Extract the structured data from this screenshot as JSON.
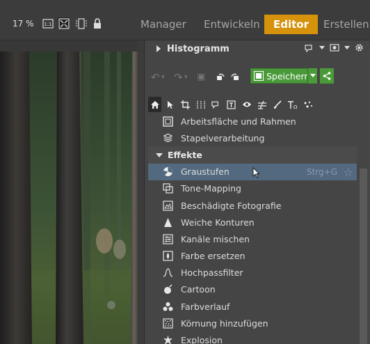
{
  "topbar": {
    "zoom": "17 %",
    "icons": [
      "one-to-one-icon",
      "fit-icon",
      "fill-icon",
      "lock-icon"
    ],
    "tabs": [
      {
        "label": "Manager",
        "active": false
      },
      {
        "label": "Entwickeln",
        "active": false
      },
      {
        "label": "Editor",
        "active": true
      },
      {
        "label": "Erstellen",
        "active": false
      }
    ]
  },
  "panel": {
    "histogram_title": "Histogramm",
    "save_label": "Speichern",
    "tool_icons": [
      "home-icon",
      "pointer-icon",
      "crop-icon",
      "transform-icon",
      "selection-icon",
      "text-frame-icon",
      "eye-icon",
      "adjust-icon",
      "brush-icon",
      "text-icon",
      "effects-icon"
    ],
    "items": [
      {
        "label": "Arbeitsfläche und Rahmen",
        "icon": "canvas-icon"
      },
      {
        "label": "Stapelverarbeitung",
        "icon": "batch-icon"
      }
    ],
    "section": "Effekte",
    "effects": [
      {
        "label": "Graustufen",
        "icon": "grayscale-icon",
        "shortcut": "Strg+G",
        "selected": true
      },
      {
        "label": "Tone-Mapping",
        "icon": "tonemapping-icon"
      },
      {
        "label": "Beschädigte Fotografie",
        "icon": "damaged-photo-icon"
      },
      {
        "label": "Weiche Konturen",
        "icon": "soft-edges-icon"
      },
      {
        "label": "Kanäle mischen",
        "icon": "channel-mixer-icon"
      },
      {
        "label": "Farbe ersetzen",
        "icon": "replace-color-icon"
      },
      {
        "label": "Hochpassfilter",
        "icon": "highpass-icon"
      },
      {
        "label": "Cartoon",
        "icon": "cartoon-icon"
      },
      {
        "label": "Farbverlauf",
        "icon": "gradient-icon"
      },
      {
        "label": "Körnung hinzufügen",
        "icon": "grain-icon"
      },
      {
        "label": "Explosion",
        "icon": "explosion-icon"
      }
    ]
  },
  "colors": {
    "accent": "#d6920a",
    "save_green": "#4a9a3a",
    "selection": "#53697f"
  }
}
